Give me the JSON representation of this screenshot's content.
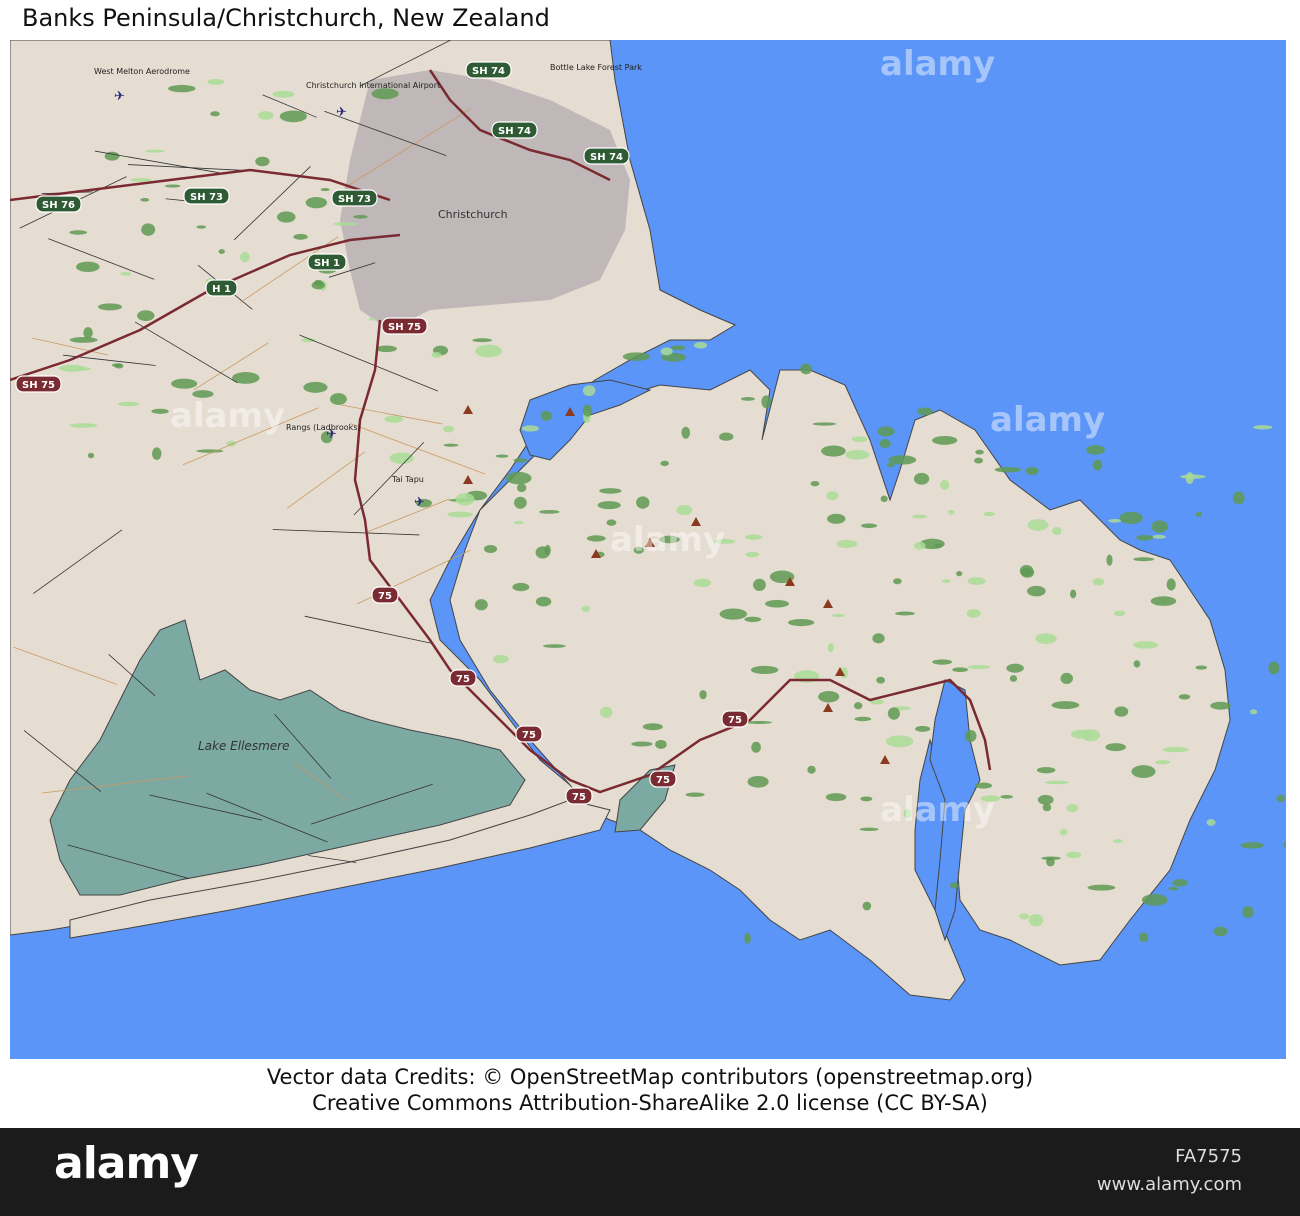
{
  "map": {
    "title": "Banks Peninsula/Christchurch, New Zealand",
    "colors": {
      "sea": "#5b95f7",
      "land": "#e6ddd2",
      "lake": "#7da9a3",
      "forest": "#5f9a52",
      "park": "#a9dc96",
      "city": "#b9b0b4",
      "state_highway": "#7a2a31",
      "minor_road": "#c89a63"
    },
    "places": {
      "lake": "Lake Ellesmere",
      "city": "Christchurch",
      "airport": "Christchurch International Airport",
      "forest_park": "Bottle Lake Forest Park",
      "aerodrome": "West Melton Aerodrome",
      "airfield": "Rangs (Ladbrooks)",
      "airfield2": "Tai Tapu"
    },
    "route_shields": [
      "SH 74",
      "SH 74",
      "SH 74",
      "SH 73",
      "SH 73",
      "SH 76",
      "SH 1",
      "H 1",
      "SH 75",
      "SH 75",
      "75",
      "75",
      "75",
      "75",
      "75",
      "75"
    ],
    "credits": {
      "line1": "Vector data Credits: © OpenStreetMap contributors (openstreetmap.org)",
      "line2": "Creative Commons Attribution-ShareAlike 2.0 license (CC BY-SA)"
    }
  },
  "watermark": {
    "brand": "alamy"
  },
  "footer": {
    "brand": "alamy",
    "image_id": "FA7575",
    "site": "www.alamy.com"
  }
}
